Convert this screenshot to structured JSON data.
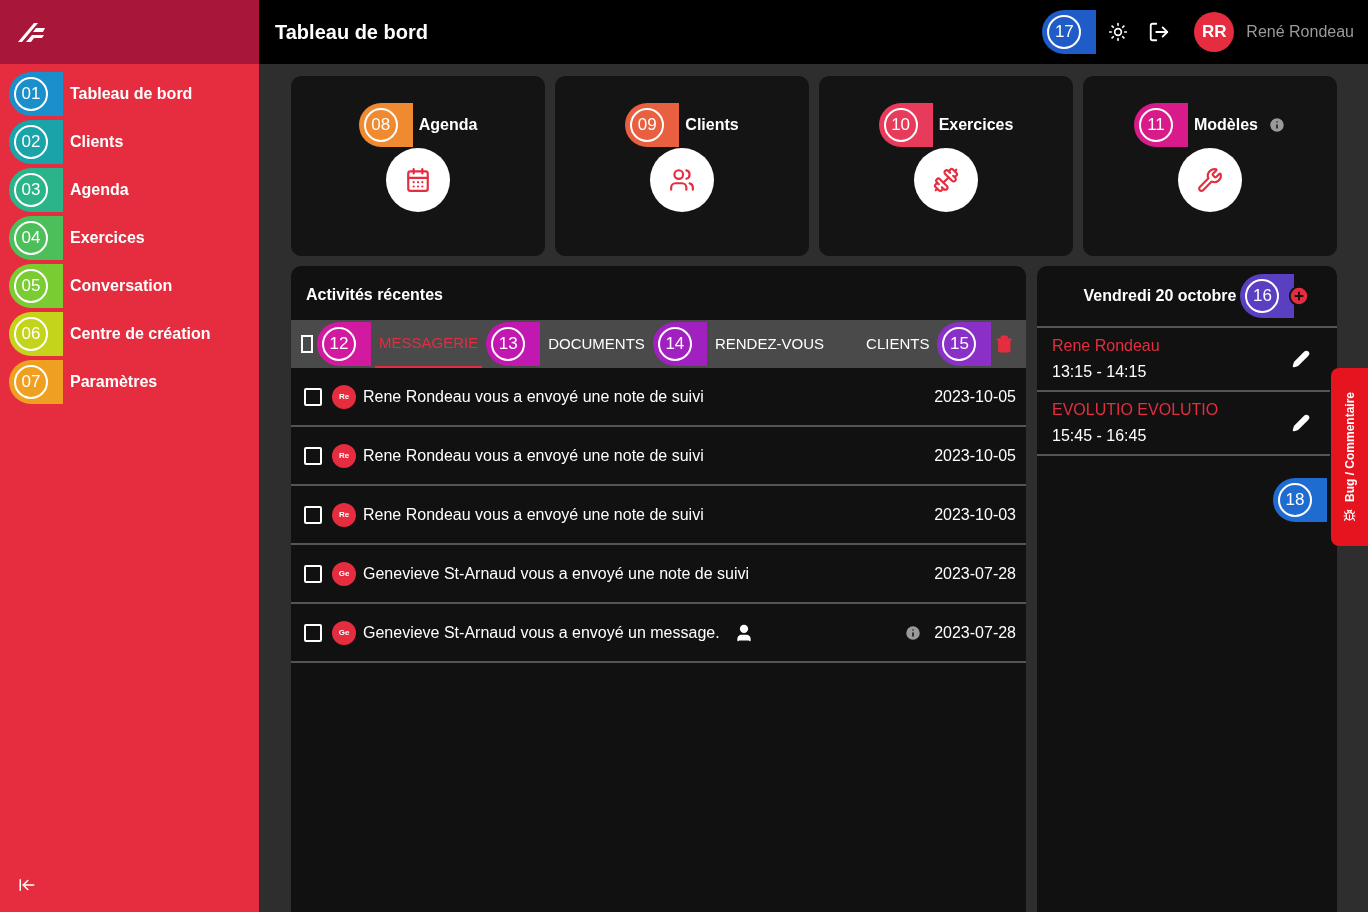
{
  "sidebar": {
    "items": [
      {
        "label": "Tableau de bord",
        "callout": {
          "number": "01",
          "color": "#1a8fc9"
        }
      },
      {
        "label": "Clients",
        "callout": {
          "number": "02",
          "color": "#1aa3a8"
        }
      },
      {
        "label": "Agenda",
        "callout": {
          "number": "03",
          "color": "#2bb38a"
        }
      },
      {
        "label": "Exercices",
        "callout": {
          "number": "04",
          "color": "#4cbf5a"
        }
      },
      {
        "label": "Conversation",
        "callout": {
          "number": "05",
          "color": "#7acc33"
        }
      },
      {
        "label": "Centre de création",
        "callout": {
          "number": "06",
          "color": "#c4d41a"
        }
      },
      {
        "label": "Paramètres",
        "callout": {
          "number": "07",
          "color": "#f0a020"
        }
      }
    ]
  },
  "topbar": {
    "title": "Tableau de bord",
    "callout": {
      "number": "17",
      "color": "#1f5cc8"
    },
    "user": {
      "initials": "RR",
      "name": "René Rondeau"
    }
  },
  "cards": [
    {
      "title": "Agenda",
      "kind": "calendar",
      "info": false,
      "callout": {
        "number": "08",
        "color": "#f08a30"
      }
    },
    {
      "title": "Clients",
      "kind": "group",
      "info": false,
      "callout": {
        "number": "09",
        "color": "#e8603f"
      }
    },
    {
      "title": "Exercices",
      "kind": "dumbbell",
      "info": false,
      "callout": {
        "number": "10",
        "color": "#e83a5a"
      }
    },
    {
      "title": "Modèles",
      "kind": "tools",
      "info": true,
      "callout": {
        "number": "11",
        "color": "#d81a8a"
      }
    }
  ],
  "activities": {
    "title": "Activités récentes",
    "tab_bar": [
      {
        "kind": "checkbox",
        "checked": false
      },
      {
        "kind": "callout",
        "number": "12",
        "color": "#d21aa0"
      },
      {
        "kind": "tab",
        "label": "MESSAGERIE",
        "selected": true
      },
      {
        "kind": "callout",
        "number": "13",
        "color": "#c018b0"
      },
      {
        "kind": "tab",
        "label": "DOCUMENTS",
        "selected": false
      },
      {
        "kind": "callout",
        "number": "14",
        "color": "#a020c0"
      },
      {
        "kind": "tab",
        "label": "RENDEZ-VOUS",
        "selected": false
      },
      {
        "kind": "tab",
        "label": "CLIENTS",
        "selected": false
      },
      {
        "kind": "callout",
        "number": "15",
        "color": "#8a30c8"
      }
    ],
    "rows": [
      {
        "checked": false,
        "avatar": "Re",
        "text": "Rene Rondeau vous a envoyé une note de suivi",
        "contact_icon": false,
        "info_icon": false,
        "date": "2023-10-05"
      },
      {
        "checked": false,
        "avatar": "Re",
        "text": "Rene Rondeau vous a envoyé une note de suivi",
        "contact_icon": false,
        "info_icon": false,
        "date": "2023-10-05"
      },
      {
        "checked": false,
        "avatar": "Re",
        "text": "Rene Rondeau vous a envoyé une note de suivi",
        "contact_icon": false,
        "info_icon": false,
        "date": "2023-10-03"
      },
      {
        "checked": false,
        "avatar": "Ge",
        "text": "Genevieve St-Arnaud vous a envoyé une note de suivi",
        "contact_icon": false,
        "info_icon": false,
        "date": "2023-07-28"
      },
      {
        "checked": false,
        "avatar": "Ge",
        "text": "Genevieve St-Arnaud vous a envoyé un message.",
        "contact_icon": true,
        "info_icon": true,
        "date": "2023-07-28"
      }
    ]
  },
  "agenda": {
    "date": "Vendredi 20 octobre",
    "callout": {
      "number": "16",
      "color": "#5a40c0"
    },
    "appointments": [
      {
        "name": "Rene Rondeau",
        "time": "13:15 - 14:15"
      },
      {
        "name": "EVOLUTIO EVOLUTIO",
        "time": "15:45 - 16:45"
      }
    ],
    "bottom_callout": {
      "number": "18",
      "color": "#1f6cd0"
    }
  },
  "feedback_tab": {
    "label": "Bug / Commentaire"
  }
}
